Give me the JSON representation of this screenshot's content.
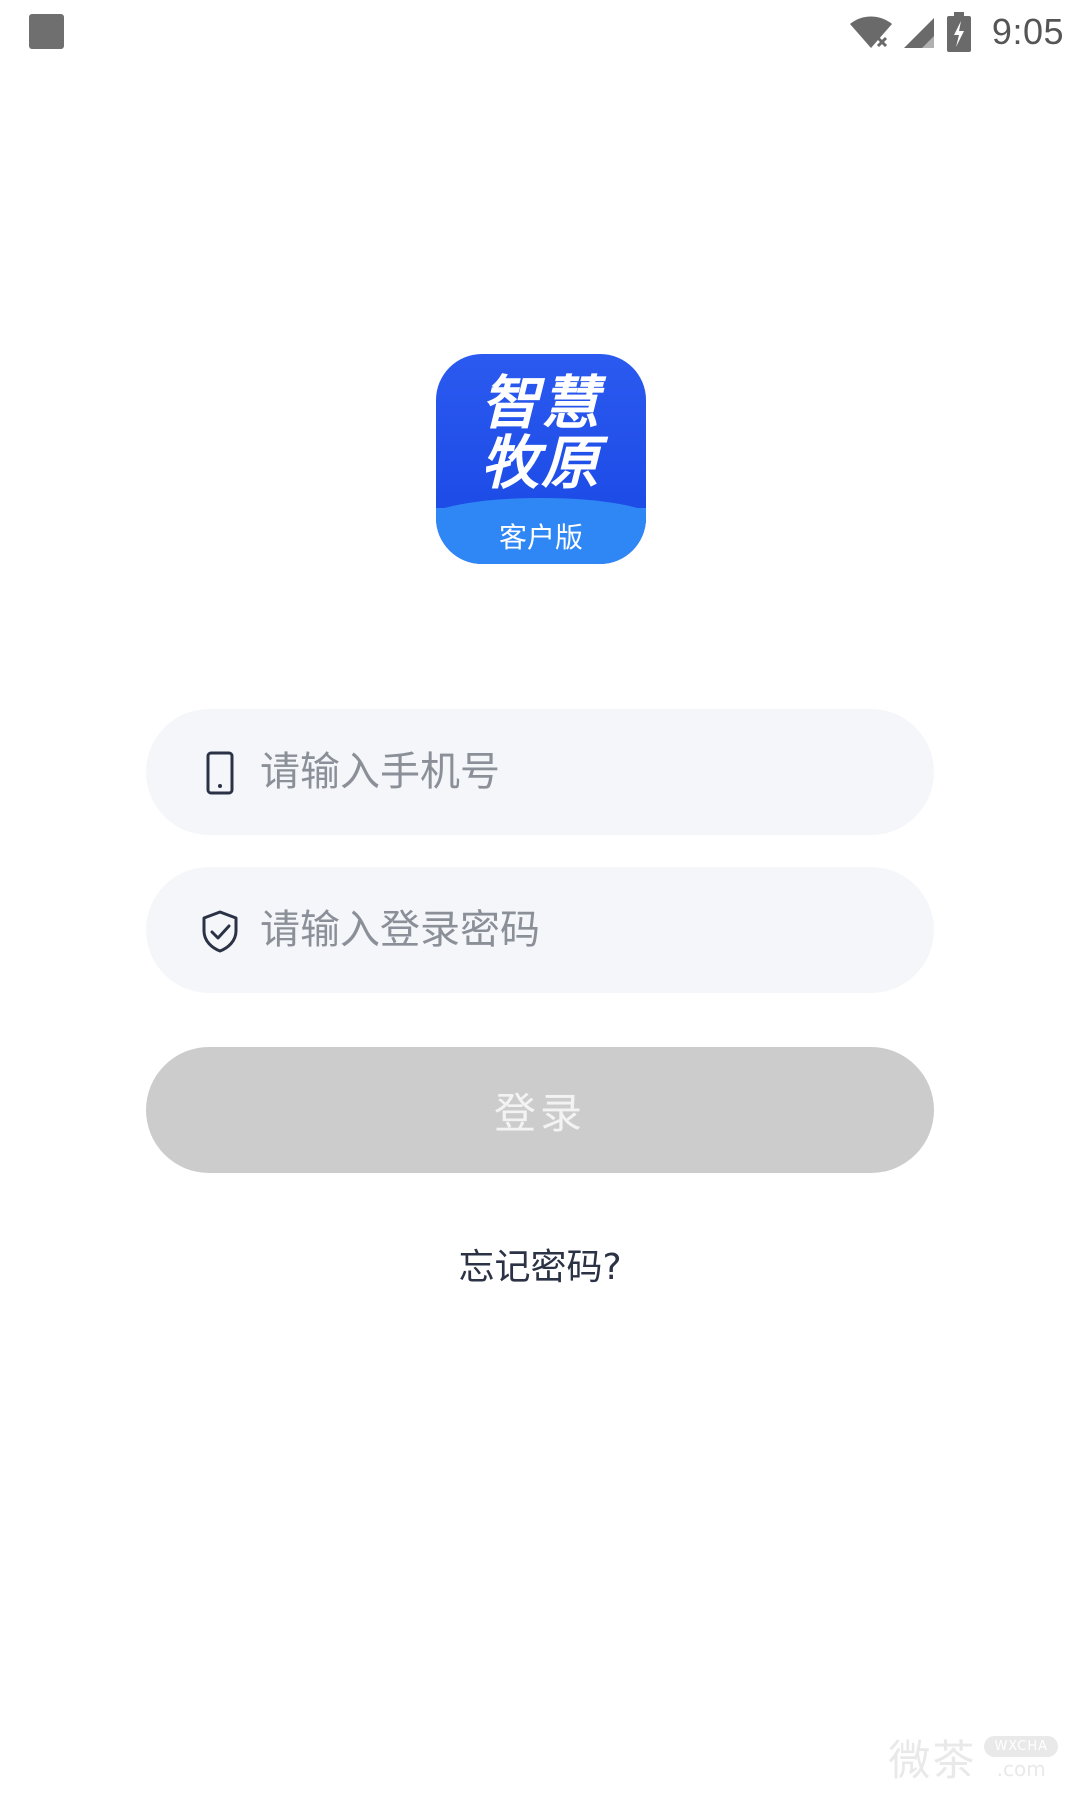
{
  "status_bar": {
    "time": "9:05",
    "icons": [
      "wifi-off-icon",
      "cell-signal-icon",
      "battery-charging-icon"
    ]
  },
  "logo": {
    "line1": "智慧",
    "line2": "牧原",
    "subtitle": "客户版",
    "colors": {
      "main": "#1f4fe8",
      "band": "#2f87f5"
    }
  },
  "form": {
    "phone": {
      "placeholder": "请输入手机号",
      "value": "",
      "icon": "phone-icon"
    },
    "password": {
      "placeholder": "请输入登录密码",
      "value": "",
      "icon": "shield-check-icon"
    }
  },
  "login_button": {
    "label": "登录",
    "color": "#cccccc",
    "text_color": "#f3f3f3"
  },
  "forgot_link": {
    "label": "忘记密码?"
  },
  "watermark": {
    "text": "微茶",
    "pill": "WXCHA",
    "suffix": ".com"
  }
}
